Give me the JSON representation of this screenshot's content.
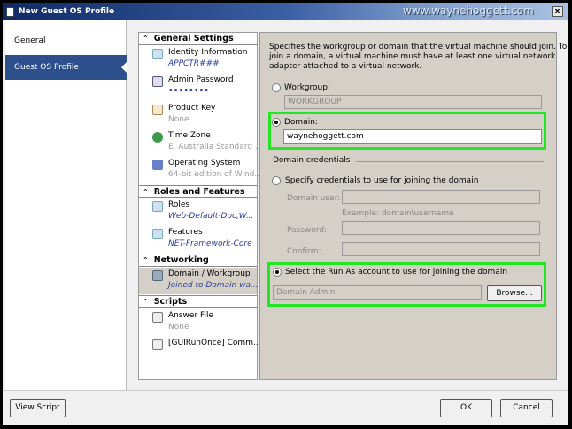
{
  "window": {
    "title": "New Guest OS Profile",
    "watermark": "www.waynehoggett.com",
    "close": "x"
  },
  "nav": {
    "items": [
      {
        "label": "General"
      },
      {
        "label": "Guest OS Profile"
      }
    ]
  },
  "tree": {
    "sections": [
      {
        "title": "General Settings",
        "items": [
          {
            "label": "Identity Information",
            "value": "APPCTR###"
          },
          {
            "label": "Admin Password",
            "value": "••••••••"
          },
          {
            "label": "Product Key",
            "value": "None"
          },
          {
            "label": "Time Zone",
            "value": "E. Australia Standard ..."
          },
          {
            "label": "Operating System",
            "value": "64-bit edition of Wind..."
          }
        ]
      },
      {
        "title": "Roles and Features",
        "items": [
          {
            "label": "Roles",
            "value": "Web-Default-Doc,W..."
          },
          {
            "label": "Features",
            "value": "NET-Framework-Core"
          }
        ]
      },
      {
        "title": "Networking",
        "items": [
          {
            "label": "Domain / Workgroup",
            "value": "Joined to Domain wa..."
          }
        ]
      },
      {
        "title": "Scripts",
        "items": [
          {
            "label": "Answer File",
            "value": "None"
          },
          {
            "label": "[GUIRunOnce] Comm...",
            "value": ""
          }
        ]
      }
    ]
  },
  "panel": {
    "description": [
      "Specifies the workgroup or domain that the virtual machine should join.  To",
      "join a domain, a virtual machine must have at least one virtual network",
      "adapter attached to a virtual network."
    ],
    "workgroup_label": "Workgroup:",
    "workgroup_value": "WORKGROUP",
    "domain_label": "Domain:",
    "domain_value": "waynehoggett.com",
    "credentials_header": "Domain credentials",
    "specify_label": "Specify credentials to use for joining the domain",
    "domain_user_label": "Domain user:",
    "example": "Example: domain\\username",
    "password_label": "Password:",
    "confirm_label": "Confirm:",
    "runas_label": "Select the Run As account to use for joining the domain",
    "runas_value": "Domain Admin",
    "browse": "Browse..."
  },
  "buttons": {
    "view_script": "View Script",
    "ok": "OK",
    "cancel": "Cancel"
  }
}
